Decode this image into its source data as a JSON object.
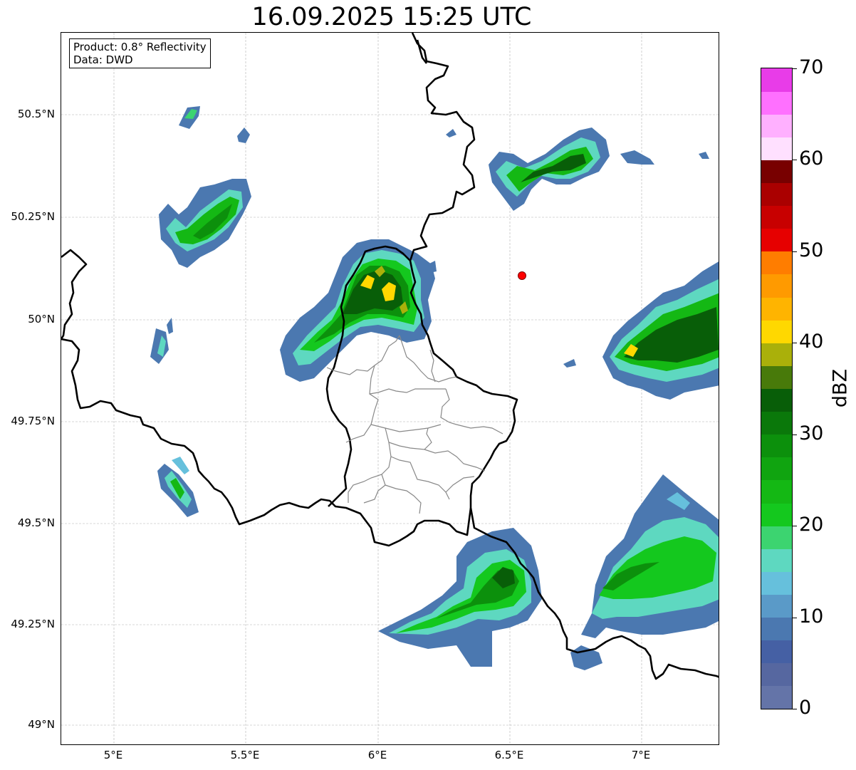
{
  "title": "16.09.2025 15:25 UTC",
  "info": {
    "product": "Product: 0.8° Reflectivity",
    "source": "Data: DWD"
  },
  "lat_ticks": [
    "50.5°N",
    "50.25°N",
    "50°N",
    "49.75°N",
    "49.5°N",
    "49.25°N",
    "49°N"
  ],
  "lon_ticks": [
    "5°E",
    "5.5°E",
    "6°E",
    "6.5°E",
    "7°E"
  ],
  "colorbar": {
    "label": "dBZ",
    "ticks": [
      "0",
      "10",
      "20",
      "30",
      "40",
      "50",
      "60",
      "70"
    ],
    "colors": [
      "#6474a8",
      "#5667a0",
      "#4560a4",
      "#4b78b0",
      "#5a9ac8",
      "#66c0dc",
      "#5ed8c0",
      "#3cd470",
      "#14c81e",
      "#14b814",
      "#10a410",
      "#0c900c",
      "#0a780a",
      "#085e08",
      "#487a0a",
      "#aab00a",
      "#ffd800",
      "#ffb400",
      "#ff9a00",
      "#ff7d00",
      "#e60000",
      "#c80000",
      "#aa0000",
      "#780000",
      "#ffe0ff",
      "#ffb0ff",
      "#ff70ff",
      "#e83ce8"
    ]
  },
  "marker": {
    "lon": 6.55,
    "lat": 50.11,
    "color": "#ff0000"
  }
}
